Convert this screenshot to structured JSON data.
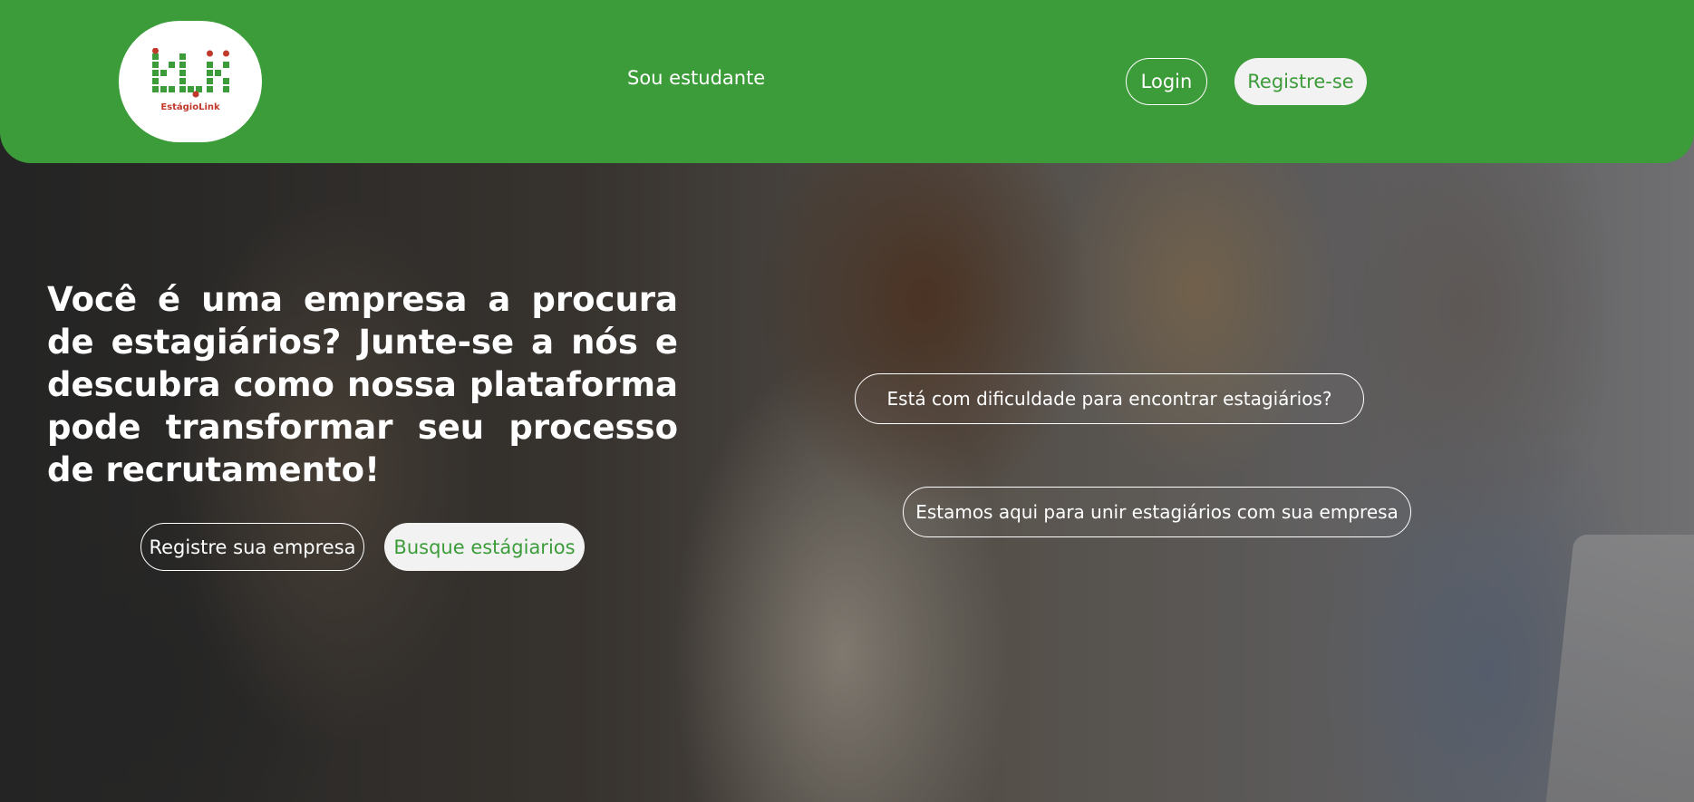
{
  "header": {
    "logo": {
      "icon": "elk-logo-icon",
      "text": "EstágioLink",
      "colors": {
        "green": "#3d9c3a",
        "red": "#c0392b"
      }
    },
    "nav_link": "Sou estudante",
    "login_label": "Login",
    "register_label": "Registre-se"
  },
  "hero": {
    "headline": "Você é uma empresa a procura de estagiários? Junte-se a nós e descubra como nossa plataforma pode transformar seu processo de recrutamento!",
    "register_company_label": "Registre sua empresa",
    "search_interns_label": "Busque estágiarios",
    "pill_1": "Está com dificuldade para encontrar estagiários?",
    "pill_2": "Estamos aqui para unir estagiários com sua empresa"
  },
  "colors": {
    "accent": "#3d9c3a",
    "button_light": "#f2f2f2",
    "text_light": "#ffffff"
  }
}
